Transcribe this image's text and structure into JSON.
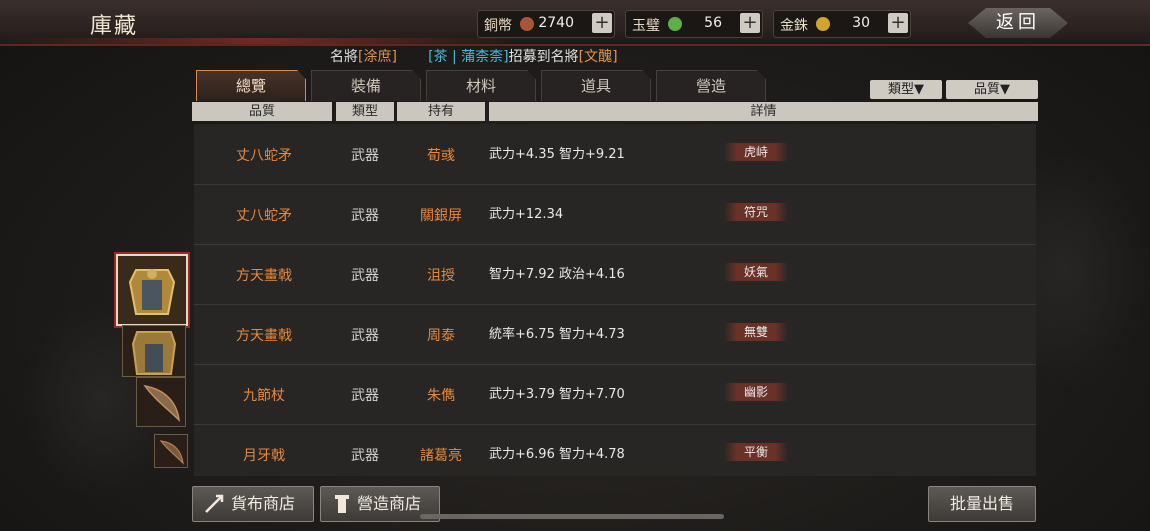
{
  "header": {
    "title": "庫藏",
    "back_label": "返回",
    "currencies": [
      {
        "label": "銅幣",
        "value": "2740",
        "coin_color": "#a8553a"
      },
      {
        "label": "玉璧",
        "value": "56",
        "coin_color": "#5fae4a"
      },
      {
        "label": "金銖",
        "value": "30",
        "coin_color": "#d1a52a"
      }
    ],
    "plus_label": "+"
  },
  "ticker": {
    "part1": "名將",
    "part2": "[涂庶]",
    "part3": "[茶 | 蒲柰柰]",
    "part4": "招募到名將",
    "part5": "[文醜]"
  },
  "tabs": [
    "總覽",
    "裝備",
    "材料",
    "道具",
    "營造"
  ],
  "active_tab": 0,
  "filters": {
    "type": "類型▼",
    "quality": "品質▼"
  },
  "columns": {
    "quality": "品質",
    "type": "類型",
    "holder": "持有",
    "details": "詳情"
  },
  "rows": [
    {
      "name": "丈八蛇矛",
      "type": "武器",
      "holder": "荀彧",
      "stats": "武力+4.35  智力+9.21",
      "skill": "虎峙"
    },
    {
      "name": "丈八蛇矛",
      "type": "武器",
      "holder": "關銀屏",
      "stats": "武力+12.34",
      "skill": "符咒"
    },
    {
      "name": "方天畫戟",
      "type": "武器",
      "holder": "沮授",
      "stats": "智力+7.92  政治+4.16",
      "skill": "妖氣"
    },
    {
      "name": "方天畫戟",
      "type": "武器",
      "holder": "周泰",
      "stats": "統率+6.75  智力+4.73",
      "skill": "無雙"
    },
    {
      "name": "九節杖",
      "type": "武器",
      "holder": "朱儁",
      "stats": "武力+3.79  智力+7.70",
      "skill": "幽影"
    },
    {
      "name": "月牙戟",
      "type": "武器",
      "holder": "諸葛亮",
      "stats": "武力+6.96  智力+4.78",
      "skill": "平衡"
    }
  ],
  "buttons": {
    "currency_shop": "貨布商店",
    "build_shop": "營造商店",
    "bulk_sell": "批量出售"
  }
}
